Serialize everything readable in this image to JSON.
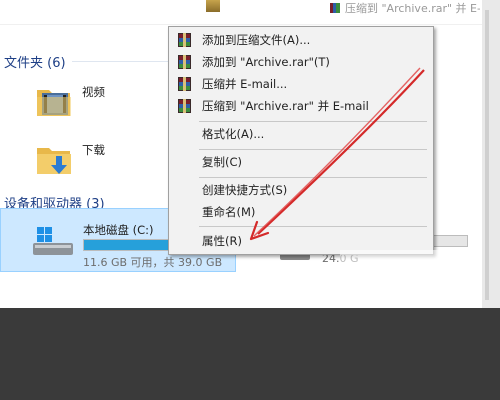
{
  "header": {
    "echo_text": "压缩到 \"Archive.rar\" 并 E-mail"
  },
  "folders_section": {
    "title": "文件夹 (6)",
    "items": [
      {
        "label": "视频",
        "icon": "video-folder-icon"
      },
      {
        "label": "下载",
        "icon": "download-folder-icon"
      }
    ]
  },
  "devices_section": {
    "title": "设备和驱动器 (3)",
    "drives": [
      {
        "label": "本地磁盘 (C:)",
        "free_text": "11.6 GB 可用，共 39.0 GB",
        "fill_fraction": 0.7,
        "selected": true
      },
      {
        "label": "",
        "free_text": "24.0 G",
        "fill_fraction": 0.0,
        "selected": false
      }
    ]
  },
  "context_menu": {
    "items": [
      {
        "label": "添加到压缩文件(A)...",
        "icon": "winrar-icon"
      },
      {
        "label": "添加到 \"Archive.rar\"(T)",
        "icon": "winrar-icon"
      },
      {
        "label": "压缩并 E-mail...",
        "icon": "winrar-icon"
      },
      {
        "label": "压缩到 \"Archive.rar\" 并 E-mail",
        "icon": "winrar-icon"
      },
      {
        "label": "格式化(A)...",
        "icon": ""
      },
      {
        "label": "复制(C)",
        "icon": ""
      },
      {
        "label": "创建快捷方式(S)",
        "icon": ""
      },
      {
        "label": "重命名(M)",
        "icon": ""
      },
      {
        "label": "属性(R)",
        "icon": ""
      }
    ]
  },
  "colors": {
    "selection": "#cde8ff",
    "drive_bar_fill": "#26a0da",
    "annotation_arrow": "#d42a2a",
    "section_title": "#1e3f86"
  }
}
